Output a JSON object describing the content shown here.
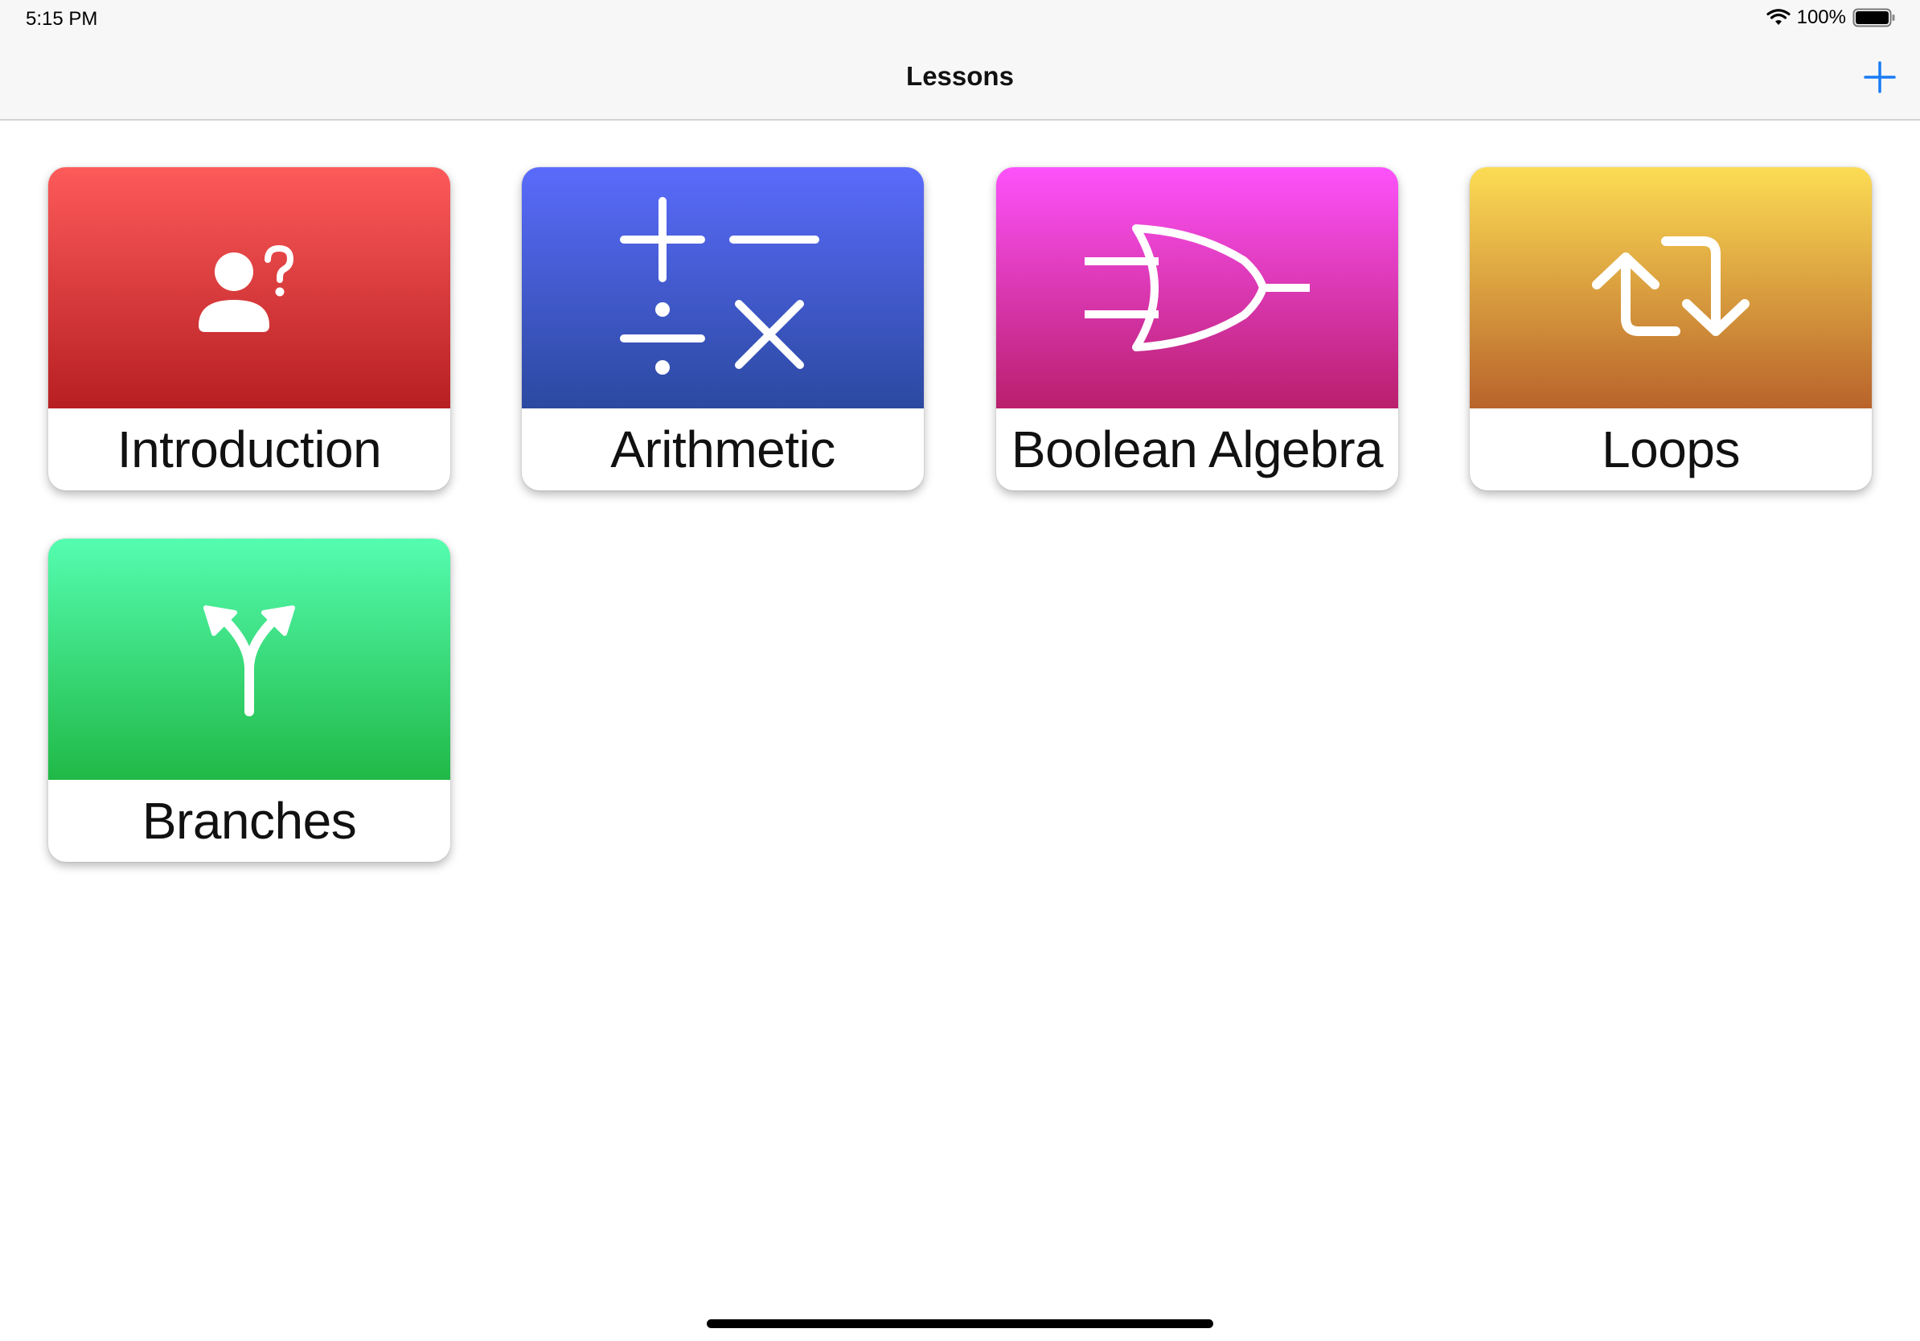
{
  "status_bar": {
    "time": "5:15 PM",
    "battery": "100%",
    "icons": [
      "wifi-icon",
      "battery-icon"
    ]
  },
  "nav": {
    "title": "Lessons",
    "add_icon": "plus-icon",
    "accent_color": "#1a7cf5"
  },
  "lessons": [
    {
      "label": "Introduction",
      "icon": "person-question-icon",
      "colors": [
        "#fd5a5a",
        "#b71f22"
      ]
    },
    {
      "label": "Arithmetic",
      "icon": "arithmetic-operators-icon",
      "colors": [
        "#5a6bfb",
        "#2b49a0"
      ]
    },
    {
      "label": "Boolean Algebra",
      "icon": "or-gate-icon",
      "colors": [
        "#fd52fb",
        "#b91f6c"
      ]
    },
    {
      "label": "Loops",
      "icon": "loop-arrows-icon",
      "colors": [
        "#fcdc54",
        "#b8632b"
      ]
    },
    {
      "label": "Branches",
      "icon": "branch-arrows-icon",
      "colors": [
        "#55fdb0",
        "#20b947"
      ]
    }
  ]
}
